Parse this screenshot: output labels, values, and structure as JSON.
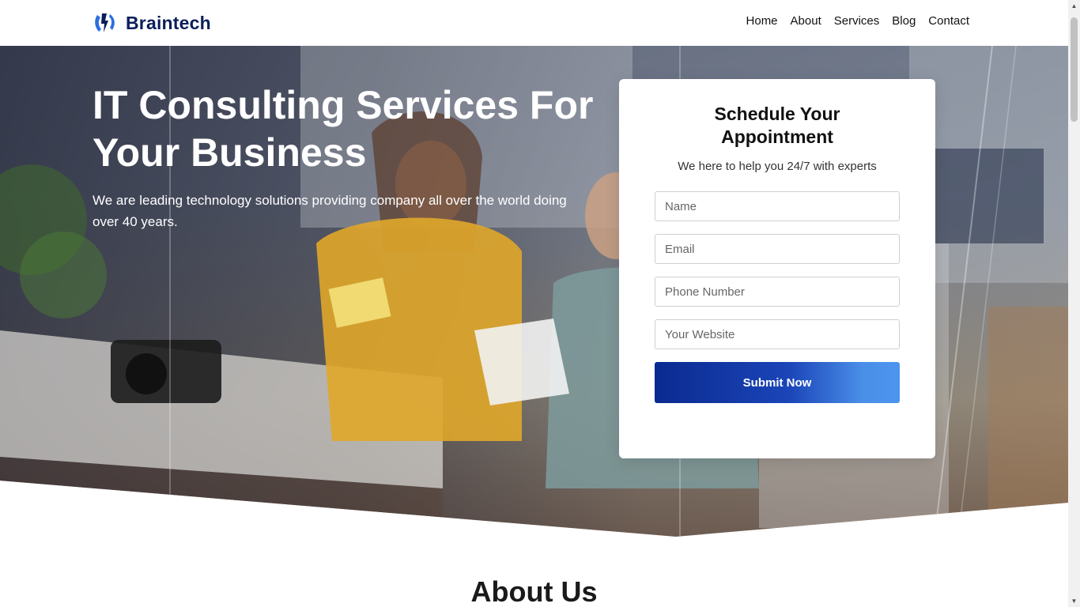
{
  "brand": {
    "name": "Braintech",
    "color": "#0b1e5b",
    "icon": "braintech-logo-icon"
  },
  "nav": {
    "items": [
      "Home",
      "About",
      "Services",
      "Blog",
      "Contact"
    ]
  },
  "hero": {
    "title": "IT Consulting Services For Your Business",
    "text": "We are leading technology solutions providing company all over the world doing over 40 years."
  },
  "form": {
    "title": "Schedule Your Appointment",
    "subtitle": "We here to help you 24/7 with experts",
    "name_placeholder": "Name",
    "email_placeholder": "Email",
    "phone_placeholder": "Phone Number",
    "website_placeholder": "Your Website",
    "submit_label": "Submit Now",
    "button_gradient": [
      "#0a2a8f",
      "#4c95ee"
    ]
  },
  "about": {
    "title": "About Us"
  }
}
